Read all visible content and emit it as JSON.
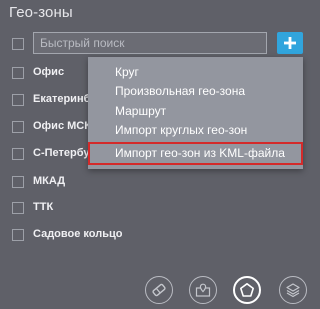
{
  "panel": {
    "title": "Гео-зоны"
  },
  "search": {
    "placeholder": "Быстрый поиск",
    "value": ""
  },
  "add_button": {
    "icon": "plus-icon",
    "color": "#31a5dd"
  },
  "zones": [
    {
      "label": "Офис",
      "checked": false
    },
    {
      "label": "Екатеринбу",
      "checked": false
    },
    {
      "label": "Офис МСК",
      "checked": false
    },
    {
      "label": "С-Петербу",
      "checked": false
    },
    {
      "label": "МКАД",
      "checked": false
    },
    {
      "label": "ТТК",
      "checked": false
    },
    {
      "label": "Садовое кольцо",
      "checked": false
    }
  ],
  "add_menu": {
    "items": [
      {
        "label": "Круг"
      },
      {
        "label": "Произвольная гео-зона"
      },
      {
        "label": "Маршрут"
      },
      {
        "label": "Импорт круглых гео-зон"
      },
      {
        "label": "Импорт гео-зон из KML-файла",
        "highlighted": true
      }
    ],
    "highlight_color": "#d42a2a"
  },
  "toolbar": {
    "buttons": [
      {
        "icon": "eraser-icon",
        "active": false
      },
      {
        "icon": "map-pin-icon",
        "active": false
      },
      {
        "icon": "pentagon-icon",
        "active": true
      },
      {
        "icon": "layers-icon",
        "active": false
      }
    ]
  }
}
